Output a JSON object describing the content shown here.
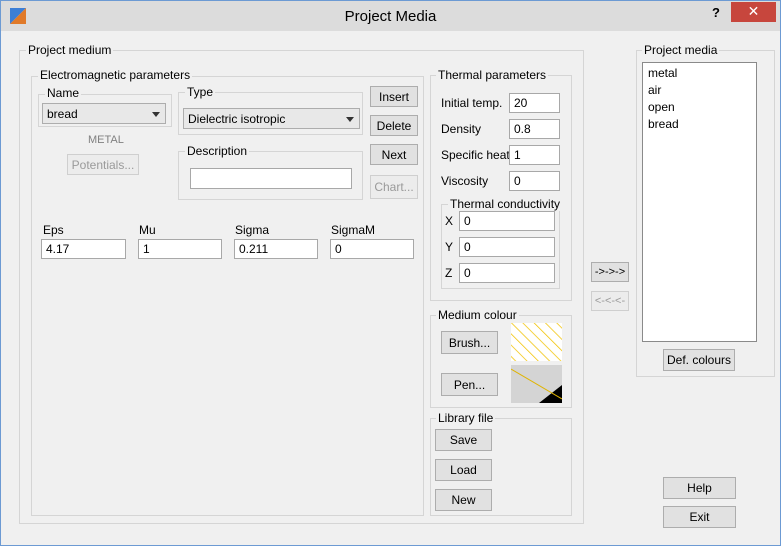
{
  "window": {
    "title": "Project Media",
    "help_symbol": "?",
    "close_symbol": "✕"
  },
  "project_medium": {
    "group_label": "Project medium",
    "em": {
      "group_label": "Electromagnetic parameters",
      "name_group_label": "Name",
      "name_value": "bread",
      "metal_label": "METAL",
      "potentials_label": "Potentials...",
      "type_group_label": "Type",
      "type_value": "Dielectric isotropic",
      "description_group_label": "Description",
      "description_value": ""
    },
    "buttons": {
      "insert": "Insert",
      "delete": "Delete",
      "next": "Next",
      "chart": "Chart..."
    },
    "fields": {
      "eps_label": "Eps",
      "eps_value": "4.17",
      "mu_label": "Mu",
      "mu_value": "1",
      "sigma_label": "Sigma",
      "sigma_value": "0.211",
      "sigmam_label": "SigmaM",
      "sigmam_value": "0"
    },
    "thermal": {
      "group_label": "Thermal parameters",
      "initial_temp_label": "Initial temp.",
      "initial_temp_value": "20",
      "density_label": "Density",
      "density_value": "0.8",
      "specific_heat_label": "Specific heat",
      "specific_heat_value": "1",
      "viscosity_label": "Viscosity",
      "viscosity_value": "0",
      "conductivity_group_label": "Thermal conductivity",
      "x_label": "X",
      "x_value": "0",
      "y_label": "Y",
      "y_value": "0",
      "z_label": "Z",
      "z_value": "0"
    },
    "colour": {
      "group_label": "Medium colour",
      "brush_label": "Brush...",
      "pen_label": "Pen...",
      "brush_color": "#f2c200",
      "pen_color": "#e0b400"
    },
    "library": {
      "group_label": "Library file",
      "save_label": "Save",
      "load_label": "Load",
      "new_label": "New"
    }
  },
  "transfer": {
    "forward_label": "->->->",
    "backward_label": "<-<-<-"
  },
  "project_media": {
    "group_label": "Project media",
    "items": [
      "metal",
      "air",
      "open",
      "bread"
    ],
    "def_colours_label": "Def. colours"
  },
  "footer": {
    "help_label": "Help",
    "exit_label": "Exit"
  }
}
